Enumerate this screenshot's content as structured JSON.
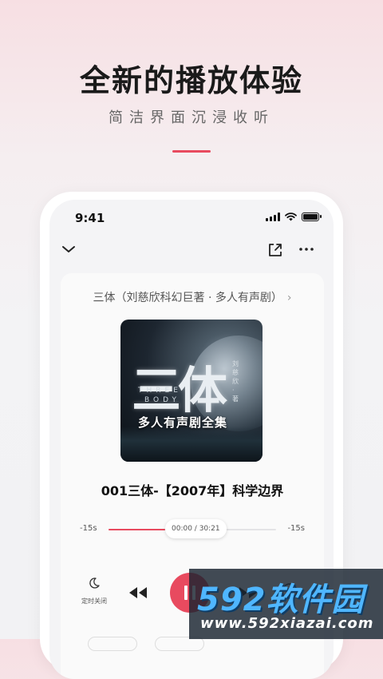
{
  "promo": {
    "headline": "全新的播放体验",
    "subline": "简洁界面沉浸收听",
    "accent_color": "#e84a5f"
  },
  "status_bar": {
    "time": "9:41",
    "icons": [
      "signal-icon",
      "wifi-icon",
      "battery-icon"
    ]
  },
  "topbar": {
    "icons": [
      "chevron-down-icon",
      "share-icon",
      "more-icon"
    ]
  },
  "album": {
    "name": "三体（刘慈欣科幻巨著 · 多人有声剧）",
    "chevron": "›",
    "cover": {
      "big_title": "三体",
      "english_line1": "THREE",
      "english_line2": "BODY",
      "author": "刘慈欣·著",
      "tagline": "多人有声剧全集"
    }
  },
  "player": {
    "episode_title": "001三体-【2007年】科学边界",
    "skip_back_label": "-15s",
    "skip_forward_label": "-15s",
    "time_display": "00:00 / 30:21",
    "progress_fraction": 0.34,
    "timer_label": "定时关闭"
  },
  "watermark": {
    "brand": "592软件园",
    "url": "www.592xiazai.com"
  }
}
